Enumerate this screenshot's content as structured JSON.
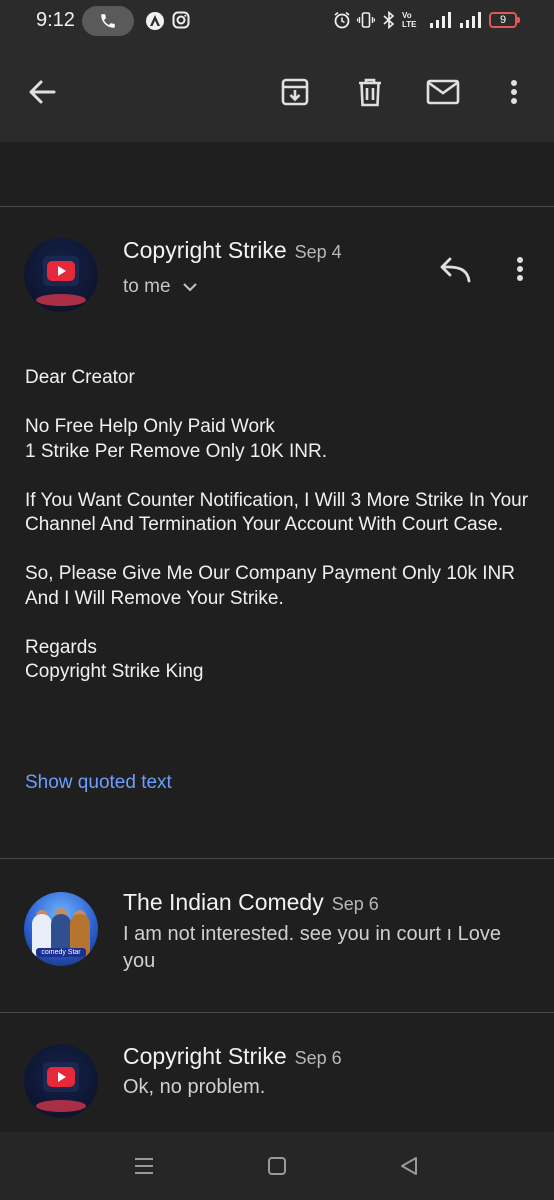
{
  "status_bar": {
    "time": "9:12",
    "icons": [
      "call-icon",
      "app-a-icon",
      "instagram-icon",
      "alarm-icon",
      "vibrate-icon",
      "bluetooth-icon",
      "volte-icon",
      "signal-icon",
      "signal-icon",
      "battery-icon"
    ],
    "volte_label": "Vo\nLTE",
    "battery_level": "9"
  },
  "app_bar": {
    "icons": [
      "back-arrow-icon",
      "archive-icon",
      "delete-icon",
      "mail-icon",
      "more-vert-icon"
    ]
  },
  "thread": {
    "messages": [
      {
        "sender": "Copyright Strike",
        "date": "Sep 4",
        "recipient": "to me",
        "body": "Dear Creator\n\nNo Free Help Only Paid Work\n1 Strike Per Remove Only 10K INR.\n\nIf You Want Counter Notification, I Will 3 More Strike In Your Channel And Termination Your Account With Court Case.\n\nSo, Please Give Me Our Company Payment Only 10k INR And I Will Remove Your Strike.\n\nRegards\nCopyright Strike King",
        "show_quoted": "Show quoted text"
      },
      {
        "sender": "The Indian Comedy",
        "date": "Sep 6",
        "snippet": "I am not interested. see you in court ı Love you",
        "avatar_tag": "comedy Star"
      },
      {
        "sender": "Copyright Strike",
        "date": "Sep 6",
        "snippet": "Ok, no problem."
      }
    ]
  },
  "nav_bar": {
    "icons": [
      "menu-icon",
      "home-icon",
      "back-icon"
    ]
  },
  "colors": {
    "background": "#1f1f1f",
    "bar": "#2b2b2b",
    "link": "#6d9eff",
    "youtube_red": "#e6293a"
  }
}
